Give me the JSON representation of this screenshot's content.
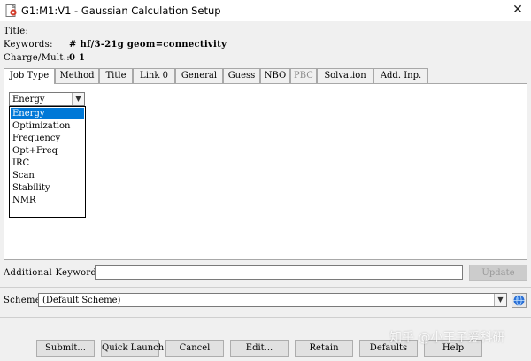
{
  "window": {
    "title": "G1:M1:V1 - Gaussian Calculation Setup",
    "close_glyph": "✕"
  },
  "header": {
    "title_label": "Title:",
    "title_value": "",
    "keywords_label": "Keywords:",
    "keywords_value": "# hf/3-21g geom=connectivity",
    "charge_label": "Charge/Mult.:",
    "charge_value": "0 1"
  },
  "tabs": [
    {
      "label": "Job Type",
      "active": true
    },
    {
      "label": "Method"
    },
    {
      "label": "Title"
    },
    {
      "label": "Link 0"
    },
    {
      "label": "General"
    },
    {
      "label": "Guess"
    },
    {
      "label": "NBO"
    },
    {
      "label": "PBC",
      "disabled": true
    },
    {
      "label": "Solvation"
    },
    {
      "label": "Add. Inp."
    }
  ],
  "job_type": {
    "selected": "Energy",
    "options": [
      "Energy",
      "Optimization",
      "Frequency",
      "Opt+Freq",
      "IRC",
      "Scan",
      "Stability",
      "NMR"
    ]
  },
  "additional_keywords": {
    "label": "Additional Keywords:",
    "value": "",
    "update_label": "Update"
  },
  "scheme": {
    "label": "Scheme:",
    "value": "(Default Scheme)"
  },
  "buttons": {
    "submit": "Submit...",
    "quick_launch": "Quick Launch",
    "cancel": "Cancel",
    "edit": "Edit...",
    "retain": "Retain",
    "defaults": "Defaults",
    "help": "Help"
  },
  "watermark": "知乎 @小王子爱科研",
  "colors": {
    "selection": "#0078d7",
    "panel_bg": "#ffffff",
    "dialog_bg": "#f0f0f0"
  }
}
